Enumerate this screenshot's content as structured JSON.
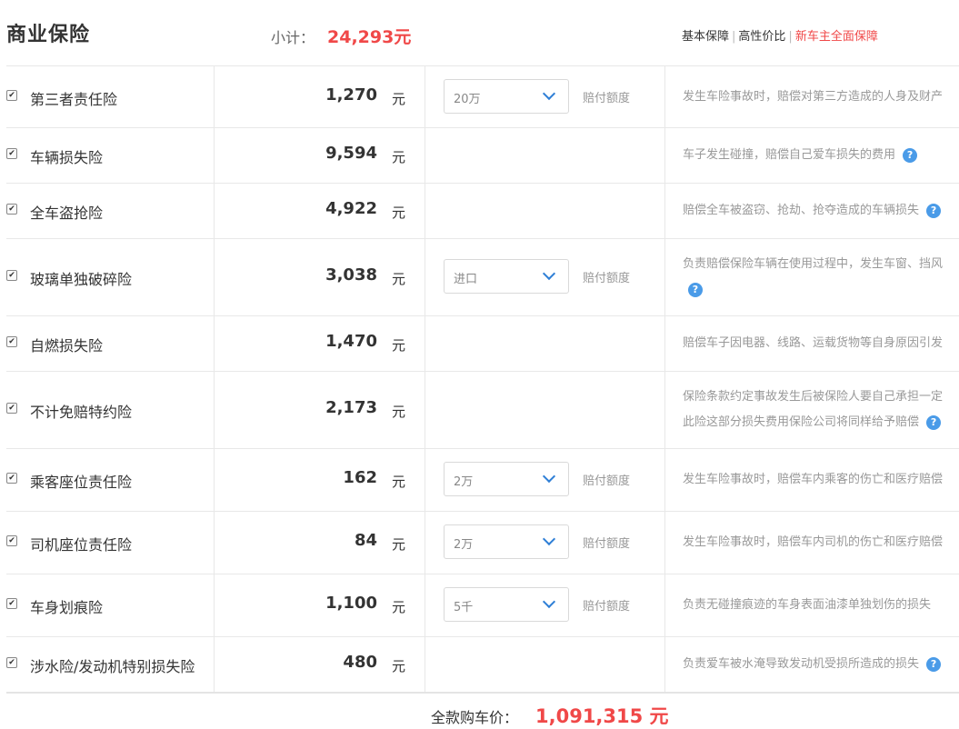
{
  "header": {
    "title": "商业保险",
    "subtotal_label": "小计：",
    "subtotal_value": "24,293元",
    "filters": [
      "基本保障",
      "高性价比",
      "新车主全面保障"
    ],
    "active_filter": "新车主全面保障"
  },
  "unit": "元",
  "amount_label": "赔付额度",
  "rows": [
    {
      "name": "第三者责任险",
      "price": "1,270",
      "checked": true,
      "select": "20万",
      "desc": [
        "发生车险事故时，赔偿对第三方造成的人身及财产"
      ],
      "help": false
    },
    {
      "name": "车辆损失险",
      "price": "9,594",
      "checked": true,
      "select": null,
      "desc": [
        "车子发生碰撞，赔偿自己爱车损失的费用"
      ],
      "help": true
    },
    {
      "name": "全车盗抢险",
      "price": "4,922",
      "checked": true,
      "select": null,
      "desc": [
        "赔偿全车被盗窃、抢劫、抢夺造成的车辆损失"
      ],
      "help": true
    },
    {
      "name": "玻璃单独破碎险",
      "price": "3,038",
      "checked": true,
      "select": "进口",
      "desc": [
        "负责赔偿保险车辆在使用过程中，发生车窗、挡风"
      ],
      "help": true
    },
    {
      "name": "自燃损失险",
      "price": "1,470",
      "checked": true,
      "select": null,
      "desc": [
        "赔偿车子因电器、线路、运载货物等自身原因引发"
      ],
      "help": false
    },
    {
      "name": "不计免赔特约险",
      "price": "2,173",
      "checked": true,
      "select": null,
      "desc": [
        "保险条款约定事故发生后被保险人要自己承担一定",
        "此险这部分损失费用保险公司将同样给予赔偿"
      ],
      "help": true
    },
    {
      "name": "乘客座位责任险",
      "price": "162",
      "checked": true,
      "select": "2万",
      "desc": [
        "发生车险事故时，赔偿车内乘客的伤亡和医疗赔偿"
      ],
      "help": false
    },
    {
      "name": "司机座位责任险",
      "price": "84",
      "checked": true,
      "select": "2万",
      "desc": [
        "发生车险事故时，赔偿车内司机的伤亡和医疗赔偿"
      ],
      "help": false
    },
    {
      "name": "车身划痕险",
      "price": "1,100",
      "checked": true,
      "select": "5千",
      "desc": [
        "负责无碰撞痕迹的车身表面油漆单独划伤的损失"
      ],
      "help": false
    },
    {
      "name": "涉水险/发动机特别损失险",
      "price": "480",
      "checked": true,
      "select": null,
      "desc": [
        "负责爱车被水淹导致发动机受损所造成的损失"
      ],
      "help": true
    }
  ],
  "total": {
    "label": "全款购车价：",
    "value": "1,091,315 元"
  },
  "colors": {
    "accent_red": "#f04848",
    "help_blue": "#4a9be8",
    "chevron_blue": "#2f7fd6"
  },
  "icons": {
    "checkbox": "checkbox-checked-icon",
    "dropdown": "chevron-down-icon",
    "help": "question-circle-icon"
  }
}
